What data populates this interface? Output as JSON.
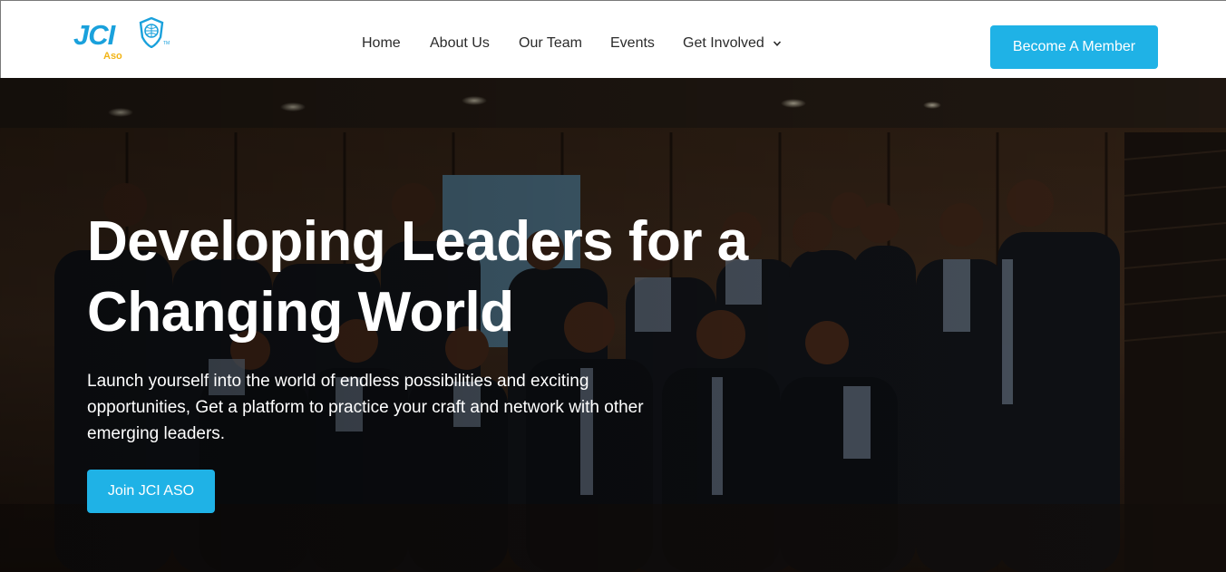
{
  "brand": {
    "logo_text": "JCI",
    "logo_sub": "Aso",
    "logo_tm": "TM",
    "accent_color": "#1fb2e6",
    "gold_color": "#f2b416"
  },
  "nav": {
    "items": [
      {
        "label": "Home"
      },
      {
        "label": "About Us"
      },
      {
        "label": "Our Team"
      },
      {
        "label": "Events"
      },
      {
        "label": "Get Involved"
      }
    ],
    "dropdown_icon": "chevron-down-icon"
  },
  "header_cta": {
    "label": "Become A Member"
  },
  "hero": {
    "title": "Developing Leaders for a Changing World",
    "subtitle": "Launch yourself into the world of endless possibilities and exciting opportunities, Get a platform to practice your craft and network with other emerging leaders.",
    "button_label": "Join JCI ASO",
    "background": "group-photo-image"
  }
}
